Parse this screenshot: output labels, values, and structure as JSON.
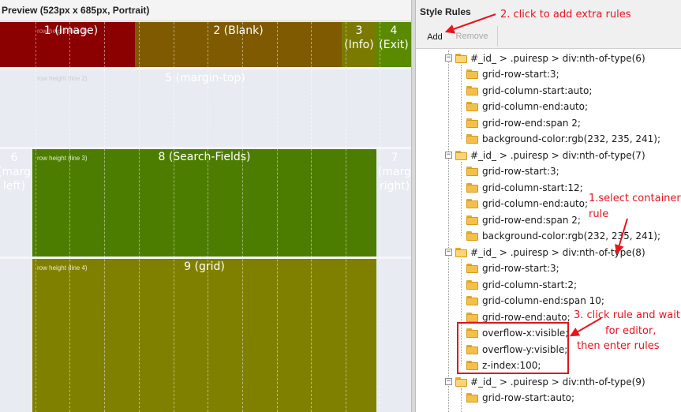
{
  "preview": {
    "title": "Preview (523px x 685px, Portrait)",
    "cells": [
      {
        "id": "image",
        "label": "1 (Image)",
        "color": "#8b0000"
      },
      {
        "id": "blank",
        "label": "2 (Blank)",
        "color": "#7f5a00"
      },
      {
        "id": "info",
        "label": "3 (Info)",
        "color": "#7a7a00"
      },
      {
        "id": "exit",
        "label": "4 (Exit)",
        "color": "#5a8a00"
      },
      {
        "id": "margin-top",
        "label": "5 (margin-top)",
        "color": "#e8ebf1"
      },
      {
        "id": "margin-left",
        "label": "6 (marg left)",
        "color": "#e8ebf1"
      },
      {
        "id": "margin-right",
        "label": "7 (marg right)",
        "color": "#e8ebf1"
      },
      {
        "id": "search-fields",
        "label": "8 (Search-Fields)",
        "color": "#4d7d00"
      },
      {
        "id": "grid",
        "label": "9 (grid)",
        "color": "#808000"
      }
    ],
    "row_hints": {
      "line1": "row height (line 1)",
      "line2": "row height (line 2)",
      "line3": "row height (line 3)",
      "line4": "row height (line 4)"
    }
  },
  "rules_panel": {
    "title": "Style Rules",
    "add_label": "Add",
    "remove_label": "Remove",
    "tree": [
      {
        "kind": "selector",
        "text": "#_id_ > .puiresp > div:nth-of-type(6)"
      },
      {
        "kind": "prop",
        "text": "grid-row-start:3;"
      },
      {
        "kind": "prop",
        "text": "grid-column-start:auto;"
      },
      {
        "kind": "prop",
        "text": "grid-column-end:auto;"
      },
      {
        "kind": "prop",
        "text": "grid-row-end:span 2;"
      },
      {
        "kind": "prop",
        "text": "background-color:rgb(232, 235, 241);"
      },
      {
        "kind": "selector",
        "text": "#_id_ > .puiresp > div:nth-of-type(7)"
      },
      {
        "kind": "prop",
        "text": "grid-row-start:3;"
      },
      {
        "kind": "prop",
        "text": "grid-column-start:12;"
      },
      {
        "kind": "prop",
        "text": "grid-column-end:auto;"
      },
      {
        "kind": "prop",
        "text": "grid-row-end:span 2;"
      },
      {
        "kind": "prop",
        "text": "background-color:rgb(232, 235, 241);"
      },
      {
        "kind": "selector",
        "text": "#_id_ > .puiresp > div:nth-of-type(8)"
      },
      {
        "kind": "prop",
        "text": "grid-row-start:3;"
      },
      {
        "kind": "prop",
        "text": "grid-column-start:2;"
      },
      {
        "kind": "prop",
        "text": "grid-column-end:span 10;"
      },
      {
        "kind": "prop",
        "text": "grid-row-end:auto;"
      },
      {
        "kind": "prop",
        "text": "overflow-x:visible;"
      },
      {
        "kind": "prop",
        "text": "overflow-y:visible;"
      },
      {
        "kind": "prop",
        "text": "z-index:100;"
      },
      {
        "kind": "selector",
        "text": "#_id_ > .puiresp > div:nth-of-type(9)"
      },
      {
        "kind": "prop",
        "text": "grid-row-start:auto;"
      }
    ]
  },
  "annotations": {
    "add_hint": "2. click to add extra rules",
    "select_hint_1": "1.select container",
    "select_hint_2": "rule",
    "edit_hint_1": "3. click rule and wait",
    "edit_hint_2": "for editor,",
    "edit_hint_3": "then enter rules",
    "color": "#e8141d"
  }
}
